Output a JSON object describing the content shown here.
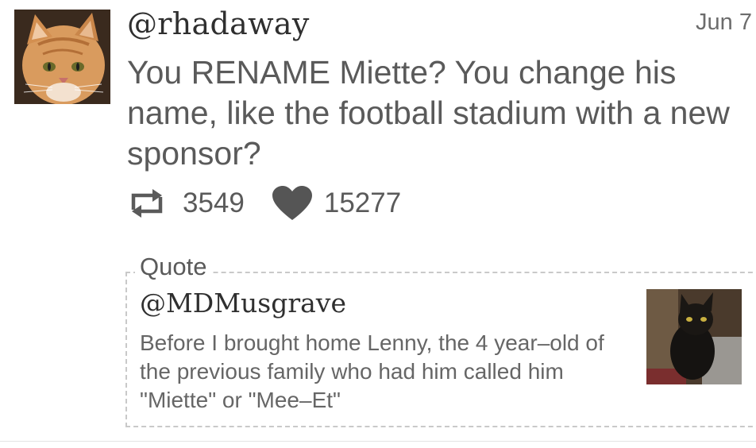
{
  "tweet": {
    "handle": "@rhadaway",
    "date": "Jun 7",
    "text": "You RENAME Miette? You change his name, like the football stadium with a new sponsor?",
    "avatar_icon": "orange-tabby-cat-photo",
    "retweet_icon": "retweet-icon",
    "retweet_count": "3549",
    "like_icon": "heart-icon",
    "like_count": "15277"
  },
  "quote": {
    "label": "Quote",
    "handle": "@MDMusgrave",
    "text": "Before I brought home Lenny, the 4 year–old of the previous family who had him called him \"Miette\" or \"Mee–Et\"",
    "thumbnail_icon": "black-cat-photo"
  },
  "colors": {
    "text": "#5a5a5a",
    "handle": "#2f2f2f",
    "icon": "#5a5a5a",
    "dashed_border": "#c9c9c9"
  }
}
